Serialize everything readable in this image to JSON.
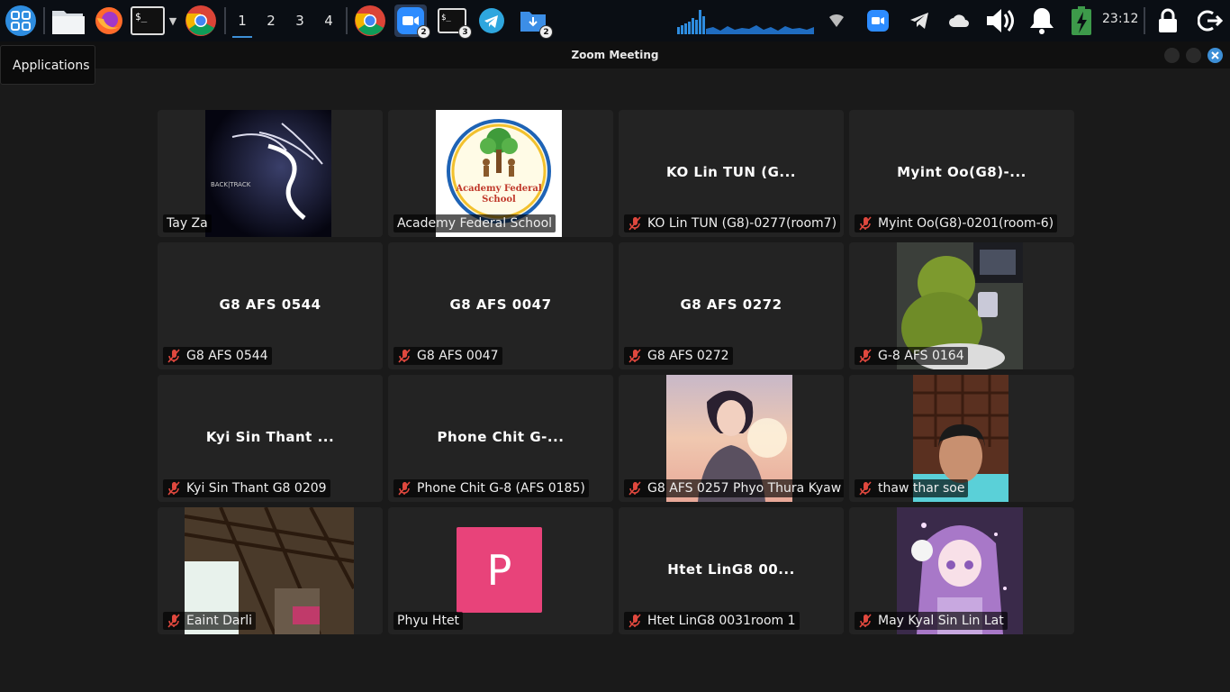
{
  "taskbar": {
    "workspaces": [
      "1",
      "2",
      "3",
      "4"
    ],
    "active_workspace": "1",
    "zoom_badge": "2",
    "terminal_badge": "3",
    "downloads_badge": "2",
    "clock": "23:12"
  },
  "tooltip": "Applications",
  "window": {
    "title": "Zoom Meeting"
  },
  "participants": [
    {
      "name": "Tay Za",
      "muted": false,
      "video": "backtrack-dragon"
    },
    {
      "name": "Academy Federal School",
      "muted": false,
      "video": "school-logo",
      "logo_text": "Academy Federal School"
    },
    {
      "name": "KO Lin TUN (G8)-0277(room7)",
      "display": "KO Lin TUN (G...",
      "muted": true
    },
    {
      "name": "Myint Oo(G8)-0201(room-6)",
      "display": "Myint Oo(G8)-...",
      "muted": true
    },
    {
      "name": "G8 AFS 0544",
      "display": "G8 AFS 0544",
      "muted": true
    },
    {
      "name": "G8 AFS 0047",
      "display": "G8 AFS 0047",
      "muted": true
    },
    {
      "name": "G8 AFS 0272",
      "display": "G8 AFS 0272",
      "muted": true
    },
    {
      "name": "G-8 AFS 0164",
      "muted": true,
      "video": "green-figure"
    },
    {
      "name": "Kyi Sin Thant G8 0209",
      "display": "Kyi Sin Thant ...",
      "muted": true
    },
    {
      "name": "Phone Chit G-8 (AFS 0185)",
      "display": "Phone Chit G-...",
      "muted": true
    },
    {
      "name": "G8 AFS 0257 Phyo Thura Kyaw",
      "muted": true,
      "video": "anime-boy"
    },
    {
      "name": "thaw thar soe",
      "muted": true,
      "video": "webcam"
    },
    {
      "name": "Eaint Darli",
      "muted": true,
      "video": "room-ceiling"
    },
    {
      "name": "Phyu Htet",
      "muted": false,
      "avatar_letter": "P",
      "avatar_color": "#e8437a"
    },
    {
      "name": "Htet LinG8 0031room 1",
      "display": "Htet LinG8 00...",
      "muted": true
    },
    {
      "name": "May Kyal Sin Lin Lat",
      "muted": true,
      "video": "anime-girl"
    }
  ],
  "colors": {
    "accent": "#3d8fd6",
    "close": "#3d8fd6",
    "mute": "#e0483e"
  }
}
